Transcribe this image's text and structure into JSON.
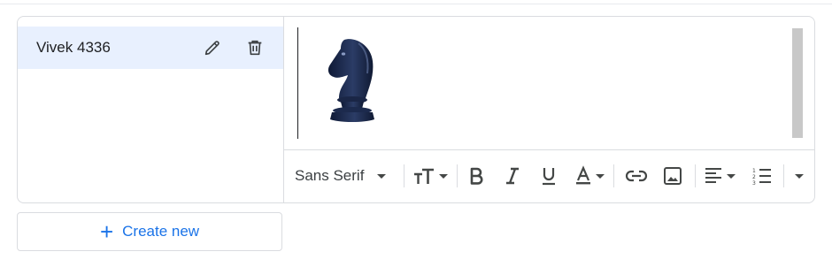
{
  "signatures": {
    "items": [
      {
        "name": "Vivek 4336",
        "selected": true
      }
    ]
  },
  "editor": {
    "content_image": "chess-knight-icon"
  },
  "toolbar": {
    "font_family": "Sans Serif",
    "buttons": [
      "font-size-icon",
      "bold-icon",
      "italic-icon",
      "underline-icon",
      "text-color-icon",
      "link-icon",
      "image-icon",
      "align-icon",
      "numbered-list-icon",
      "more-formatting-icon"
    ]
  },
  "create_button": {
    "label": "Create new"
  },
  "colors": {
    "accent": "#1a73e8",
    "selected_bg": "#e8f0fe",
    "border": "#dadce0",
    "icon": "#5f6368"
  }
}
